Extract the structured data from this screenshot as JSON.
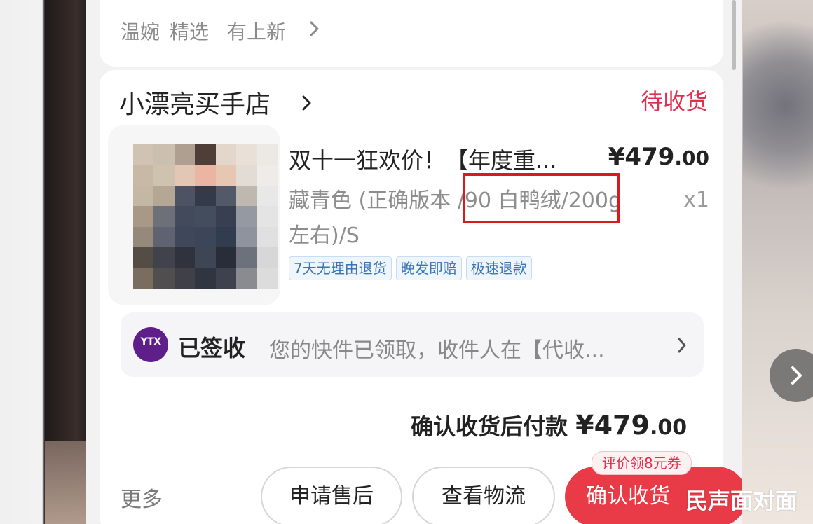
{
  "top": {
    "tab1": "温婉",
    "tab2": "精选",
    "tab3": "有上新"
  },
  "shop": {
    "name": "小漂亮买手店",
    "status": "待收货"
  },
  "product": {
    "title": "双十一狂欢价！【年度重...",
    "price_symbol": "¥",
    "price_int": "479",
    "price_dec": ".00",
    "variant": "藏青色 (正确版本 /90 白鸭绒/200g左右)/S",
    "qty": "x1",
    "tags": [
      "7天无理由退货",
      "晚发即赔",
      "极速退款"
    ]
  },
  "logistics": {
    "logo_text": "YTX",
    "status": "已签收",
    "message": "您的快件已领取，收件人在【代收..."
  },
  "payment": {
    "label": "确认收货后付款",
    "symbol": "¥",
    "int": "479",
    "dec": ".00"
  },
  "actions": {
    "more": "更多",
    "after_sales": "申请售后",
    "view_logistics": "查看物流",
    "confirm": "确认收货",
    "coupon": "评价领8元券"
  },
  "watermark": "民声面对面",
  "colors": {
    "accent_red": "#e83b47",
    "status_red": "#e0304e",
    "tag_blue": "#3b73b9",
    "highlight": "#d71920"
  },
  "icons": {
    "next": "chevron-right-icon",
    "chevron": "chevron-right-icon",
    "avatar": "pixelated-product-image"
  }
}
